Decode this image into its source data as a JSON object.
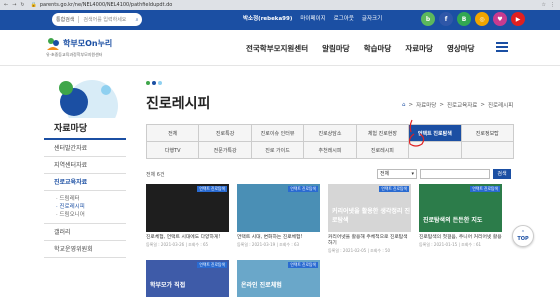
{
  "browser": {
    "url": "parents.go.kr/ne/NEL4000/NEL4100/pathfieldupdt.do"
  },
  "topbar": {
    "search_select": "통합검색",
    "search_placeholder": "검색어를 입력하세요",
    "user": "박소정(rebeka99)",
    "links": [
      "마이페이지",
      "로그아웃",
      "글자크기"
    ],
    "circles": [
      {
        "label": "b",
        "color": "#5cb85c"
      },
      {
        "label": "f",
        "color": "#2f57a8"
      },
      {
        "label": "B",
        "color": "#32a852"
      },
      {
        "label": "◎",
        "color": "#f0a500"
      },
      {
        "label": "♥",
        "color": "#c83b8f"
      },
      {
        "label": "▶",
        "color": "#e02020"
      }
    ]
  },
  "header": {
    "logo_text": "학부모On누리",
    "logo_sub": "유·초중등교육과정학부모지원센터",
    "gnb": [
      "전국학부모지원센터",
      "알림마당",
      "학습마당",
      "자료마당",
      "영상마당"
    ]
  },
  "sidebar": {
    "title": "자료마당",
    "items": [
      {
        "label": "센터발간자료",
        "active": false
      },
      {
        "label": "지역센터자료",
        "active": false
      },
      {
        "label": "진로교육자료",
        "active": true
      }
    ],
    "subs": [
      {
        "label": "· 드림레터",
        "on": false
      },
      {
        "label": "· 진로레시피",
        "on": true
      },
      {
        "label": "· 드림오니어",
        "on": false
      }
    ],
    "items2": [
      {
        "label": "갤러리"
      },
      {
        "label": "학교운영위원회"
      }
    ]
  },
  "page": {
    "title": "진로레시피",
    "breadcrumb": [
      "자료마당",
      "진로교육자료",
      "진로레시피"
    ]
  },
  "tabs": [
    {
      "label": "전체",
      "active": false
    },
    {
      "label": "진로특강",
      "active": false
    },
    {
      "label": "진로이슈 인터뷰",
      "active": false
    },
    {
      "label": "진로상담소",
      "active": false
    },
    {
      "label": "체험 진로현장",
      "active": false
    },
    {
      "label": "언택트 진로탐색",
      "active": true
    },
    {
      "label": "진로정보탑",
      "active": false
    },
    {
      "label": "다행TV",
      "active": false
    },
    {
      "label": "전문가특강",
      "active": false
    },
    {
      "label": "진로 가이드",
      "active": false
    },
    {
      "label": "추천레시피",
      "active": false
    },
    {
      "label": "진로레시피",
      "active": false
    },
    {
      "label": "",
      "active": false
    },
    {
      "label": "",
      "active": false
    }
  ],
  "list": {
    "count_text": "전체 6건",
    "filter_select": "전체",
    "search_button": "검색"
  },
  "cards": [
    {
      "badge": "언택트 진로탐색",
      "headline": "",
      "bg": "#1e1e1e",
      "title": "진로체험, 언택트 시대에도 다양하게!",
      "meta": "등록일 : 2021-03-26  |  조회수 : 65"
    },
    {
      "badge": "언택트 진로탐색",
      "headline": "",
      "bg": "#4a8fb5",
      "title": "언택트 시대, 변화하는 진로체험!",
      "meta": "등록일 : 2021-03-19  |  조회수 : 63"
    },
    {
      "badge": "언택트 진로탐색",
      "headline": "커리어넷을 활용한 생각정리 진로탐색",
      "bg": "#d6d6d6",
      "title": "커리어넷을 활용해 주체적으로 진로탐색하기",
      "meta": "등록일 : 2021-02-05  |  조회수 : 50"
    },
    {
      "badge": "언택트 진로탐색",
      "headline": "진로탐색의 든든한 지도",
      "bg": "#2c7c4a",
      "title": "진로탐색의 첫걸음, 주니어 커리어넷 활용",
      "meta": "등록일 : 2021-01-15  |  조회수 : 61"
    },
    {
      "badge": "언택트 진로탐색",
      "headline": "학부모가 직접",
      "bg": "#3e5ba8",
      "title": "",
      "meta": ""
    },
    {
      "badge": "언택트 진로탐색",
      "headline": "온라인 진로체험",
      "bg": "#6aa7c9",
      "title": "",
      "meta": ""
    }
  ],
  "top_button": "TOP",
  "colors": {
    "brand": "#1b4fa3",
    "annotation": "#e02020"
  }
}
